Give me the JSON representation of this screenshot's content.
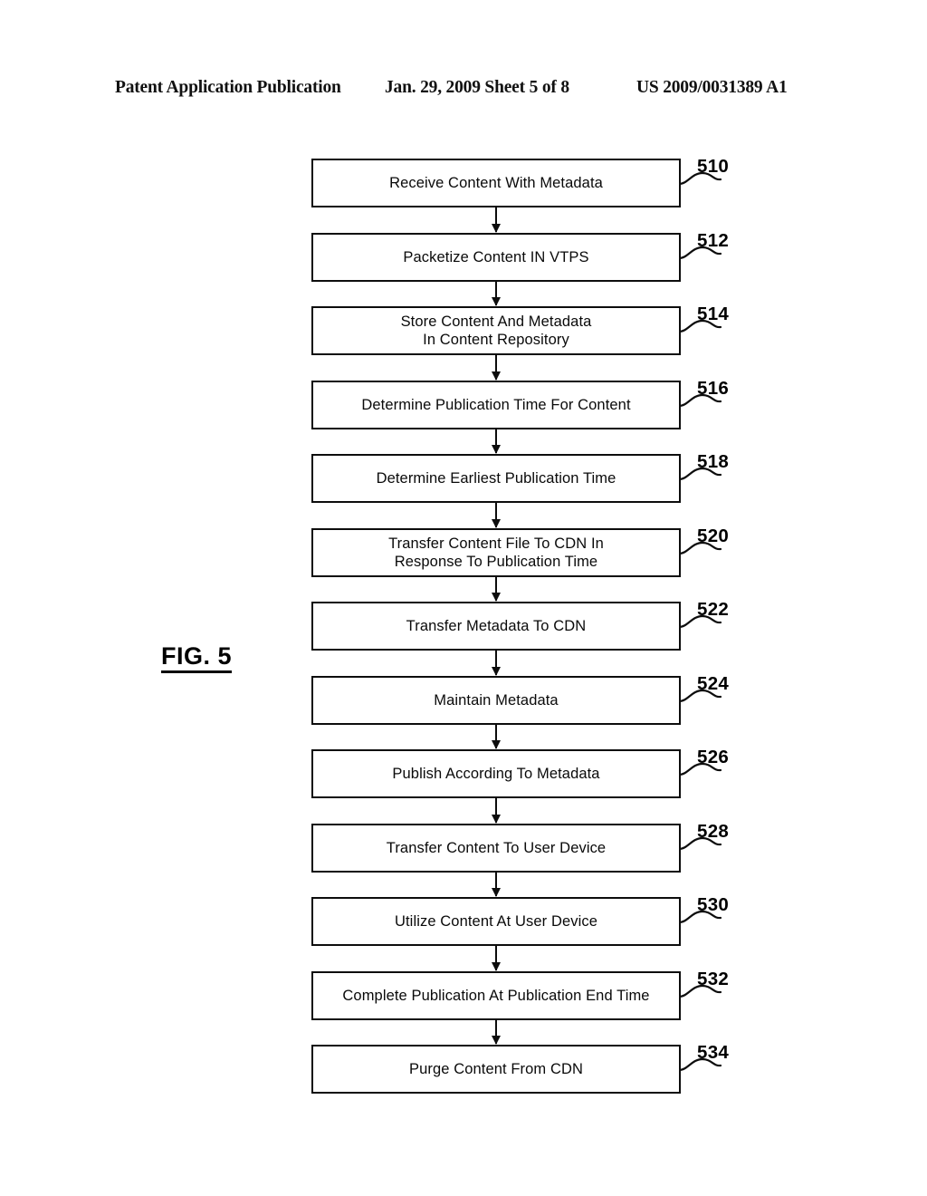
{
  "page": {
    "background_color": "#ffffff",
    "ink_color": "#000000"
  },
  "header": {
    "publication": "Patent Application Publication",
    "date_sheet": "Jan. 29, 2009  Sheet 5 of 8",
    "patent_number": "US 2009/0031389 A1"
  },
  "figure": {
    "label": "FIG. 5"
  },
  "flowchart": {
    "type": "flowchart",
    "orientation": "vertical",
    "connector": "arrow-down",
    "nodes": [
      {
        "ref": "510",
        "text": "Receive Content With Metadata",
        "lines": 1
      },
      {
        "ref": "512",
        "text": "Packetize Content IN VTPS",
        "lines": 1
      },
      {
        "ref": "514",
        "text": "Store Content And Metadata\nIn Content Repository",
        "lines": 2
      },
      {
        "ref": "516",
        "text": "Determine Publication Time For Content",
        "lines": 1
      },
      {
        "ref": "518",
        "text": "Determine Earliest Publication Time",
        "lines": 1
      },
      {
        "ref": "520",
        "text": "Transfer Content File To CDN In\nResponse To Publication Time",
        "lines": 2
      },
      {
        "ref": "522",
        "text": "Transfer Metadata To CDN",
        "lines": 1
      },
      {
        "ref": "524",
        "text": "Maintain Metadata",
        "lines": 1
      },
      {
        "ref": "526",
        "text": "Publish According To Metadata",
        "lines": 1
      },
      {
        "ref": "528",
        "text": "Transfer Content To User Device",
        "lines": 1
      },
      {
        "ref": "530",
        "text": "Utilize Content At User Device",
        "lines": 1
      },
      {
        "ref": "532",
        "text": "Complete Publication At Publication End Time",
        "lines": 1
      },
      {
        "ref": "534",
        "text": "Purge Content From CDN",
        "lines": 1
      }
    ]
  }
}
